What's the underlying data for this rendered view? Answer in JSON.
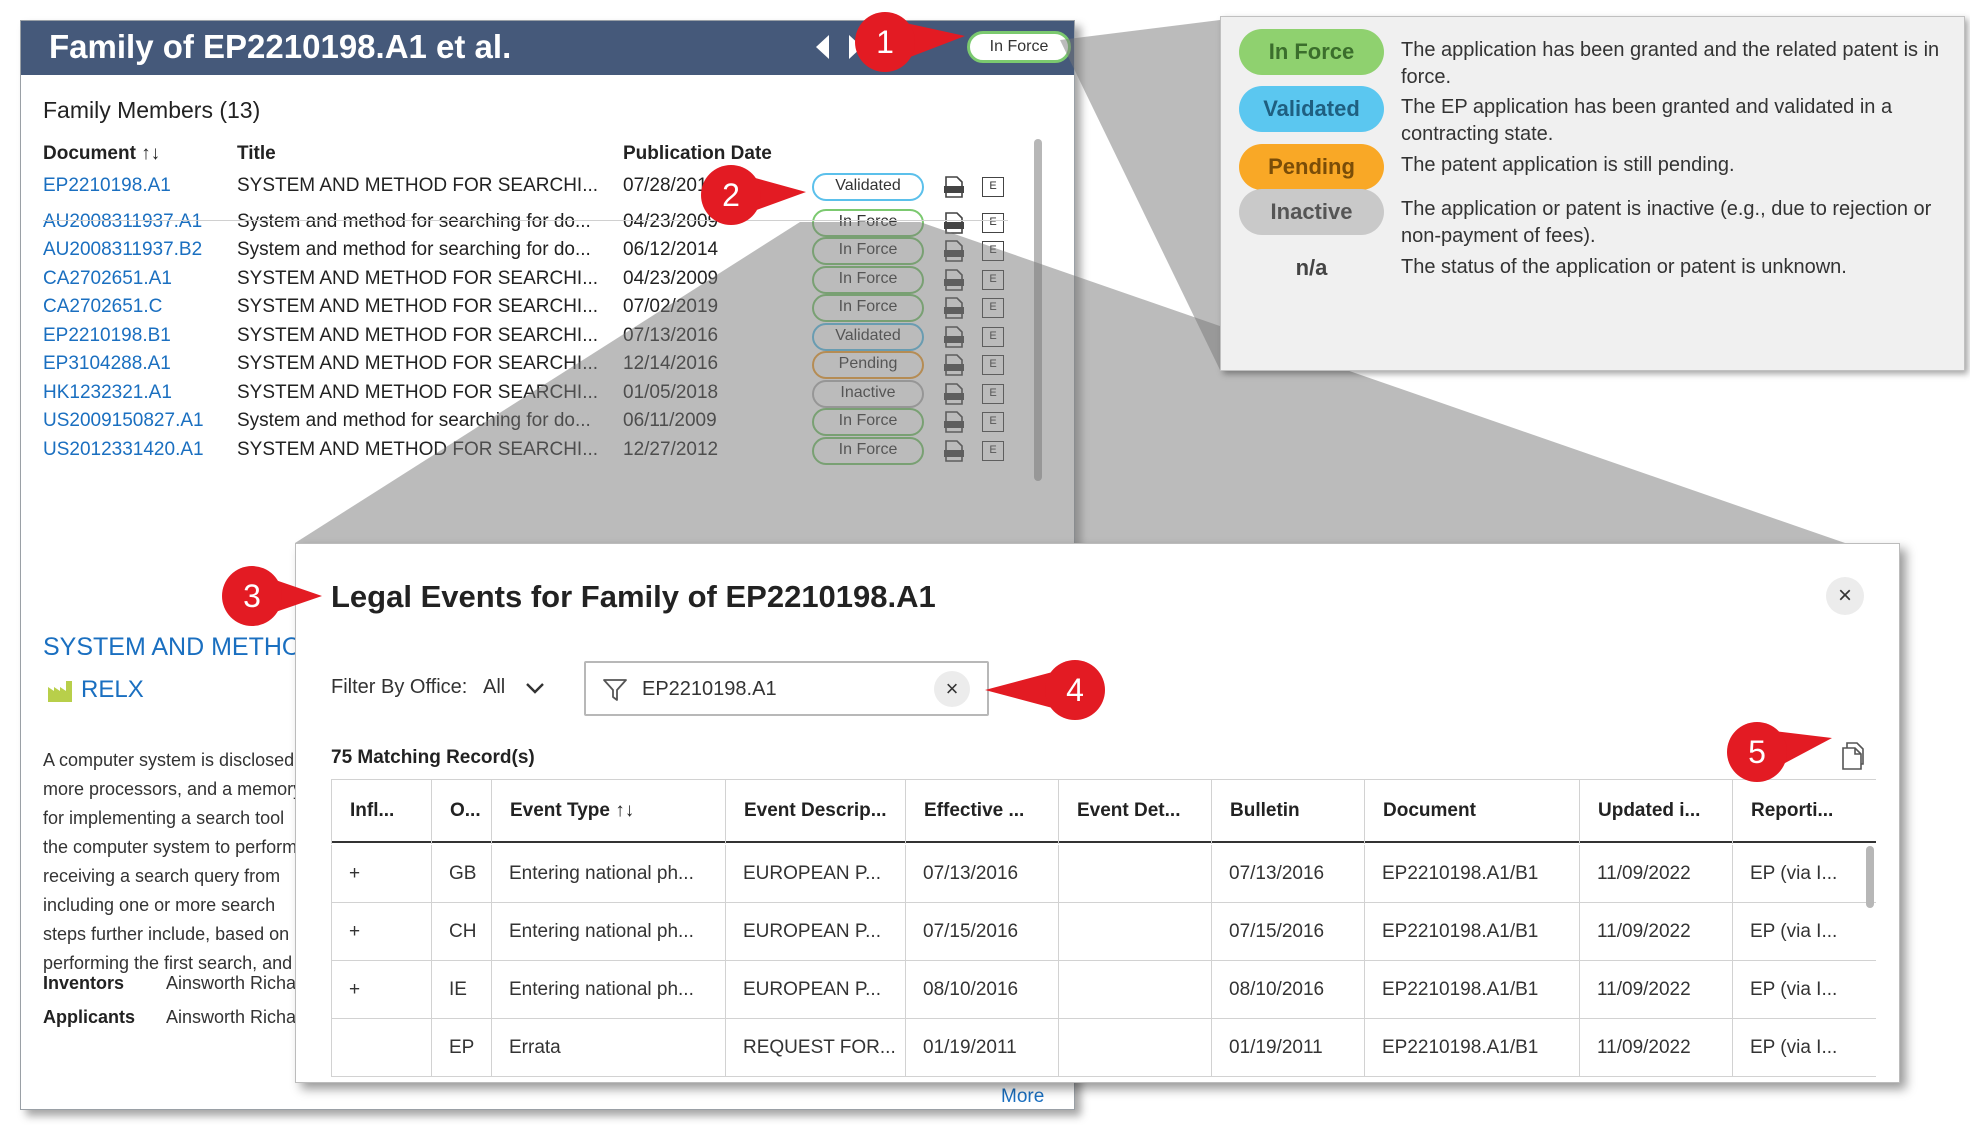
{
  "family": {
    "title": "Family of EP2210198.A1 et al.",
    "header_status": "In Force",
    "members_heading": "Family Members (13)",
    "columns": {
      "document": "Document ↑↓",
      "title": "Title",
      "publication_date": "Publication Date"
    },
    "members": [
      {
        "document": "EP2210198.A1",
        "title": "SYSTEM AND METHOD FOR SEARCHI...",
        "date": "07/28/2010",
        "status": "Validated",
        "status_color": "#5bc0eb"
      },
      {
        "document": "AU2008311937.A1",
        "title": "System and method for searching for do...",
        "date": "04/23/2009",
        "status": "In Force",
        "status_color": "#7bc96f"
      },
      {
        "document": "AU2008311937.B2",
        "title": "System and method for searching for do...",
        "date": "06/12/2014",
        "status": "In Force",
        "status_color": "#7bc96f"
      },
      {
        "document": "CA2702651.A1",
        "title": "SYSTEM AND METHOD FOR SEARCHI...",
        "date": "04/23/2009",
        "status": "In Force",
        "status_color": "#7bc96f"
      },
      {
        "document": "CA2702651.C",
        "title": "SYSTEM AND METHOD FOR SEARCHI...",
        "date": "07/02/2019",
        "status": "In Force",
        "status_color": "#7bc96f"
      },
      {
        "document": "EP2210198.B1",
        "title": "SYSTEM AND METHOD FOR SEARCHI...",
        "date": "07/13/2016",
        "status": "Validated",
        "status_color": "#5bc0eb"
      },
      {
        "document": "EP3104288.A1",
        "title": "SYSTEM AND METHOD FOR SEARCHI...",
        "date": "12/14/2016",
        "status": "Pending",
        "status_color": "#f3a030"
      },
      {
        "document": "HK1232321.A1",
        "title": "SYSTEM AND METHOD FOR SEARCHI...",
        "date": "01/05/2018",
        "status": "Inactive",
        "status_color": "#b5b5b5"
      },
      {
        "document": "US2009150827.A1",
        "title": "System and method for searching for do...",
        "date": "06/11/2009",
        "status": "In Force",
        "status_color": "#7bc96f"
      },
      {
        "document": "US2012331420.A1",
        "title": "SYSTEM AND METHOD FOR SEARCHI...",
        "date": "12/27/2012",
        "status": "In Force",
        "status_color": "#7bc96f"
      }
    ],
    "e_label": "E",
    "summary_title": "SYSTEM AND METHOD FOR SEARCHING",
    "assignee": "RELX",
    "abstract_lines": [
      "A computer system is disclosed",
      "more processors, and a memory",
      "for implementing a search tool",
      "the computer system to perform",
      "receiving a search query from",
      "including one or more search",
      "steps further include, based on",
      "performing the first search, and"
    ],
    "inventors_label": "Inventors",
    "inventors_value": "Ainsworth Richard",
    "applicants_label": "Applicants",
    "applicants_value": "Ainsworth Richard",
    "more_link": "More"
  },
  "legend": {
    "items": [
      {
        "label": "In Force",
        "color": "#8fd16f",
        "text_color": "#3b6e2c",
        "description": "The application has been granted and the related patent is in force."
      },
      {
        "label": "Validated",
        "color": "#5bc7f0",
        "text_color": "#1f5f80",
        "description": "The EP application has been granted and validated in a contracting state."
      },
      {
        "label": "Pending",
        "color": "#f9a826",
        "text_color": "#7a4d08",
        "description": "The patent application is still pending."
      },
      {
        "label": "Inactive",
        "color": "#c9c9c9",
        "text_color": "#555555",
        "description": "The application or patent is inactive (e.g., due to rejection or non-payment of fees)."
      },
      {
        "label": "n/a",
        "color": "",
        "text_color": "#444444",
        "description": "The status of the application or patent is unknown."
      }
    ]
  },
  "legal_events": {
    "title": "Legal Events for Family of EP2210198.A1",
    "close_symbol": "×",
    "filter_label": "Filter By Office:",
    "filter_value": "All",
    "search_value": "EP2210198.A1",
    "clear_symbol": "×",
    "record_count": "75 Matching Record(s)",
    "columns": [
      "Infl...",
      "O...",
      "Event Type ↑↓",
      "Event Descrip...",
      "Effective ...",
      "Event Det...",
      "Bulletin",
      "Document",
      "Updated i...",
      "Reporti..."
    ],
    "rows": [
      [
        "+",
        "GB",
        "Entering national ph...",
        "EUROPEAN P...",
        "07/13/2016",
        "",
        "07/13/2016",
        "EP2210198.A1/B1",
        "11/09/2022",
        "EP (via I..."
      ],
      [
        "+",
        "CH",
        "Entering national ph...",
        "EUROPEAN P...",
        "07/15/2016",
        "",
        "07/15/2016",
        "EP2210198.A1/B1",
        "11/09/2022",
        "EP (via I..."
      ],
      [
        "+",
        "IE",
        "Entering national ph...",
        "EUROPEAN P...",
        "08/10/2016",
        "",
        "08/10/2016",
        "EP2210198.A1/B1",
        "11/09/2022",
        "EP (via I..."
      ],
      [
        "",
        "EP",
        "Errata",
        "REQUEST FOR...",
        "01/19/2011",
        "",
        "01/19/2011",
        "EP2210198.A1/B1",
        "11/09/2022",
        "EP (via I..."
      ]
    ]
  },
  "callouts": [
    "1",
    "2",
    "3",
    "4",
    "5"
  ],
  "colors": {
    "header_bg": "#45597a",
    "link": "#1a6fc0",
    "callout": "#e31b23"
  }
}
